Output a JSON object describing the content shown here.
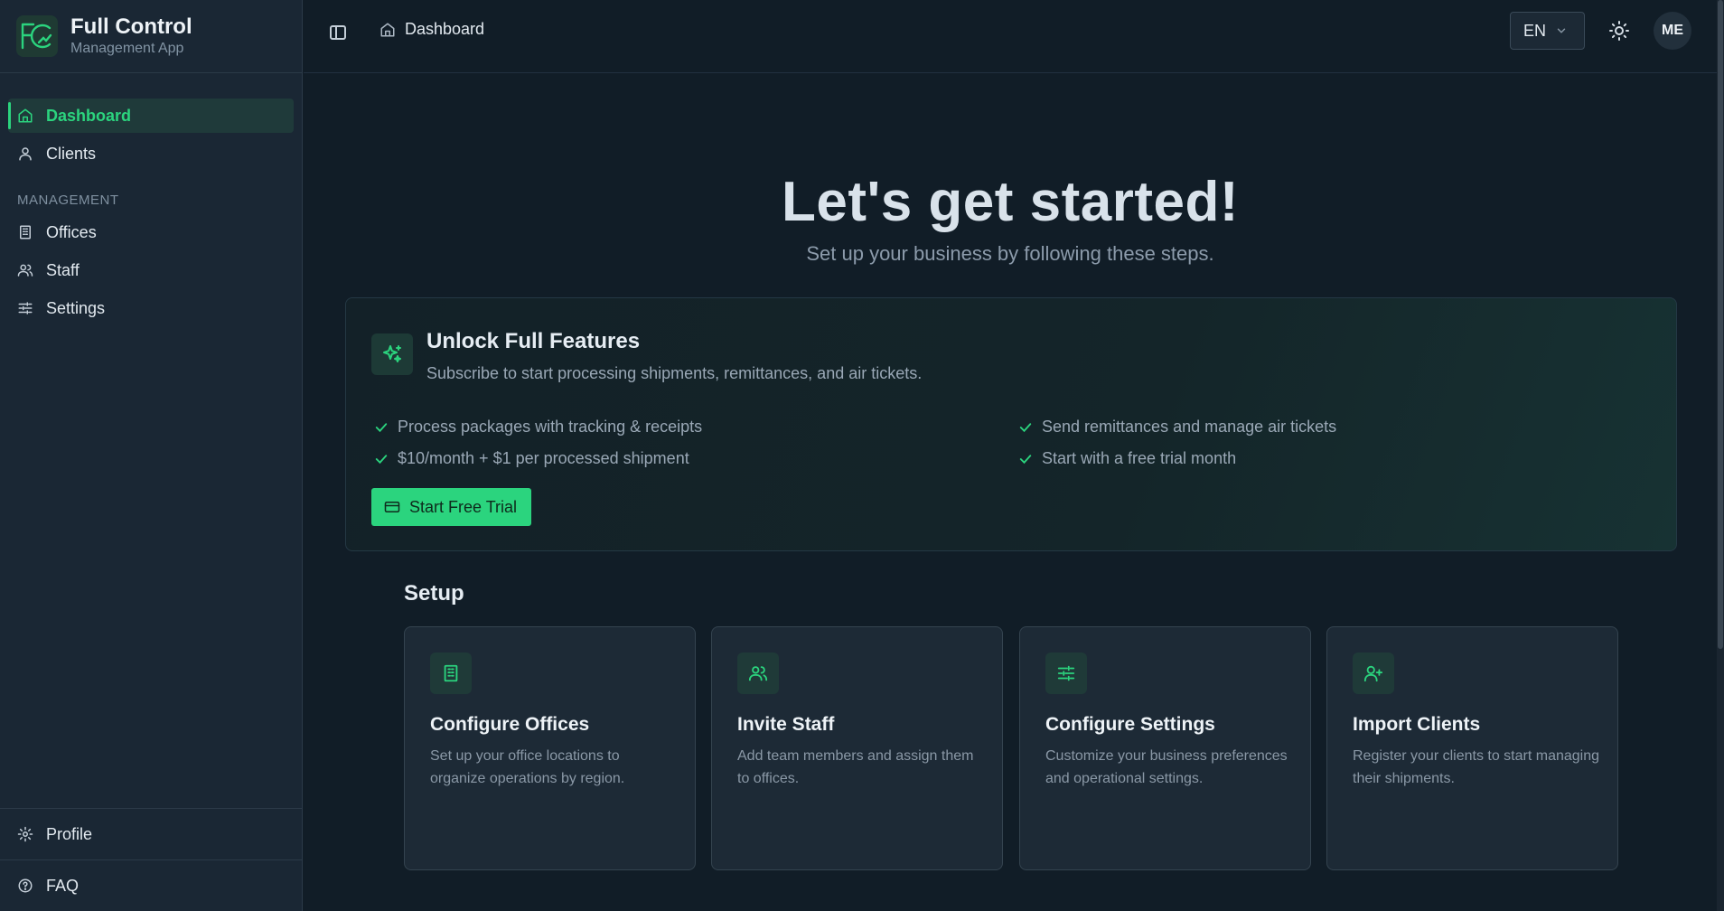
{
  "brand": {
    "title": "Full Control",
    "subtitle": "Management App"
  },
  "sidebar": {
    "items": [
      {
        "label": "Dashboard",
        "icon": "home-icon",
        "active": true
      },
      {
        "label": "Clients",
        "icon": "user-icon"
      }
    ],
    "section_label": "MANAGEMENT",
    "management_items": [
      {
        "label": "Offices",
        "icon": "building-icon"
      },
      {
        "label": "Staff",
        "icon": "users-icon"
      },
      {
        "label": "Settings",
        "icon": "sliders-icon"
      }
    ],
    "bottom": [
      {
        "label": "Profile",
        "icon": "gear-icon"
      },
      {
        "label": "FAQ",
        "icon": "help-circle-icon"
      }
    ]
  },
  "header": {
    "breadcrumb": "Dashboard",
    "language": "EN",
    "avatar_initials": "ME"
  },
  "hero": {
    "title": "Let's get started!",
    "subtitle": "Set up your business by following these steps."
  },
  "unlock": {
    "title": "Unlock Full Features",
    "subtitle": "Subscribe to start processing shipments, remittances, and air tickets.",
    "features": [
      "Process packages with tracking & receipts",
      "Send remittances and manage air tickets",
      "$10/month + $1 per processed shipment",
      "Start with a free trial month"
    ],
    "button_label": "Start Free Trial"
  },
  "setup": {
    "title": "Setup",
    "cards": [
      {
        "title": "Configure Offices",
        "description": "Set up your office locations to organize operations by region.",
        "icon": "building-icon"
      },
      {
        "title": "Invite Staff",
        "description": "Add team members and assign them to offices.",
        "icon": "users-icon"
      },
      {
        "title": "Configure Settings",
        "description": "Customize your business preferences and operational settings.",
        "icon": "sliders-icon"
      },
      {
        "title": "Import Clients",
        "description": "Register your clients to start managing their shipments.",
        "icon": "user-plus-icon"
      }
    ]
  },
  "colors": {
    "accent": "#2bd47e",
    "background": "#111d27",
    "sidebar": "#1a2734",
    "card": "#1d2a36"
  }
}
